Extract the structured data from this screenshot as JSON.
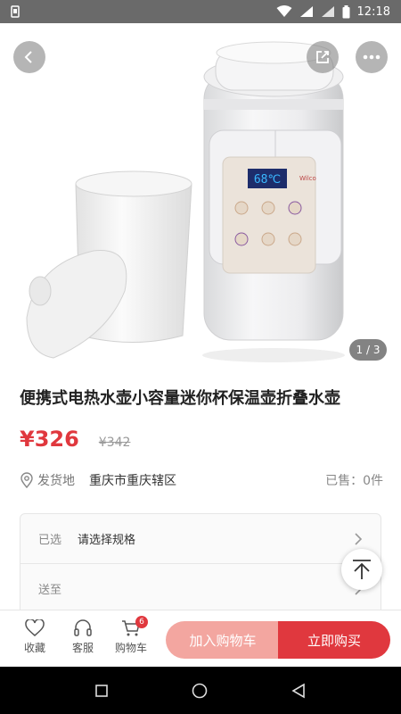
{
  "status_bar": {
    "time": "12:18"
  },
  "gallery": {
    "page_indicator": "1 / 3",
    "display_temp": "68℃",
    "brand": "Wilco"
  },
  "product": {
    "title": "便携式电热水壶小容量迷你杯保温壶折叠水壶",
    "price": "¥326",
    "original_price": "¥342"
  },
  "shipping": {
    "label": "发货地",
    "city": "重庆市重庆辖区",
    "sold": "已售：0件"
  },
  "options": [
    {
      "label": "已选",
      "value": "请选择规格"
    },
    {
      "label": "送至",
      "value": ""
    }
  ],
  "bottom_bar": {
    "favorite": "收藏",
    "service": "客服",
    "cart": "购物车",
    "cart_badge": "6",
    "add_to_cart": "加入购物车",
    "buy_now": "立即购买"
  },
  "colors": {
    "accent": "#e0383e",
    "accent_light": "#f3a6a0"
  }
}
